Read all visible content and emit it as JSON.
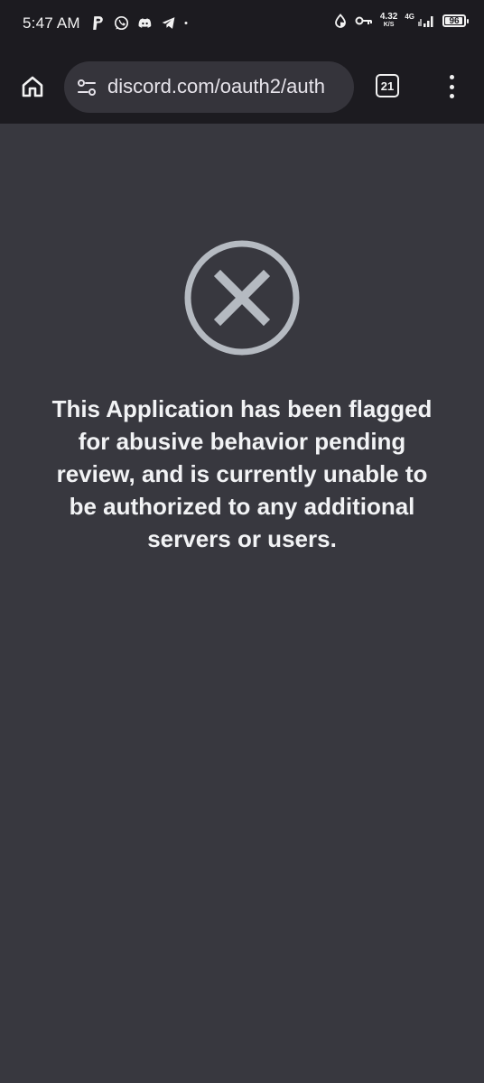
{
  "status_bar": {
    "time": "5:47 AM",
    "network_speed": "4.32",
    "network_speed_unit": "K/S",
    "network_type": "4G",
    "battery": "96",
    "battery_level": 0.96
  },
  "browser": {
    "url": "discord.com/oauth2/auth",
    "tab_count": "21"
  },
  "page": {
    "error_message": "This Application has been flagged for abusive behavior pending review, and is currently unable to be authorized to any additional servers or users.",
    "colors": {
      "background": "#38383f",
      "icon": "#b5bac1",
      "text": "#f2f3f5"
    }
  }
}
